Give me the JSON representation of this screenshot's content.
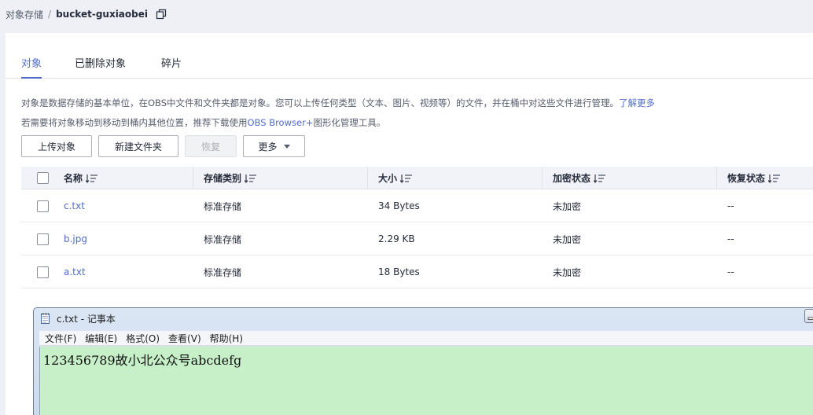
{
  "breadcrumb": {
    "root": "对象存储",
    "separator": "/",
    "current": "bucket-guxiaobei",
    "copy_icon": "copy-icon"
  },
  "tabs": [
    {
      "label": "对象",
      "active": true
    },
    {
      "label": "已删除对象",
      "active": false
    },
    {
      "label": "碎片",
      "active": false
    }
  ],
  "description": {
    "line1": "对象是数据存储的基本单位，在OBS中文件和文件夹都是对象。您可以上传任何类型（文本、图片、视频等）的文件，并在桶中对这些文件进行管理。",
    "line1_link": "了解更多",
    "line2_prefix": "若需要将对象移动到移动到桶内其他位置，推荐下载使用",
    "line2_highlight": "OBS Browser+",
    "line2_suffix": "图形化管理工具。"
  },
  "toolbar": {
    "upload": "上传对象",
    "new_folder": "新建文件夹",
    "restore": "恢复",
    "more": "更多"
  },
  "table": {
    "columns": [
      "名称",
      "存储类别",
      "大小",
      "加密状态",
      "恢复状态"
    ],
    "rows": [
      {
        "name": "c.txt",
        "storage": "标准存储",
        "size": "34 Bytes",
        "encryption": "未加密",
        "restore": "--"
      },
      {
        "name": "b.jpg",
        "storage": "标准存储",
        "size": "2.29 KB",
        "encryption": "未加密",
        "restore": "--"
      },
      {
        "name": "a.txt",
        "storage": "标准存储",
        "size": "18 Bytes",
        "encryption": "未加密",
        "restore": "--"
      }
    ]
  },
  "notepad": {
    "title": "c.txt - 记事本",
    "menus": [
      "文件(F)",
      "编辑(E)",
      "格式(O)",
      "查看(V)",
      "帮助(H)"
    ],
    "content": "123456789故小北公众号abcdefg",
    "editor_bg": "#c7f0c8"
  },
  "colors": {
    "accent": "#526ecc",
    "text": "#252b3a",
    "muted": "#575d6c"
  }
}
